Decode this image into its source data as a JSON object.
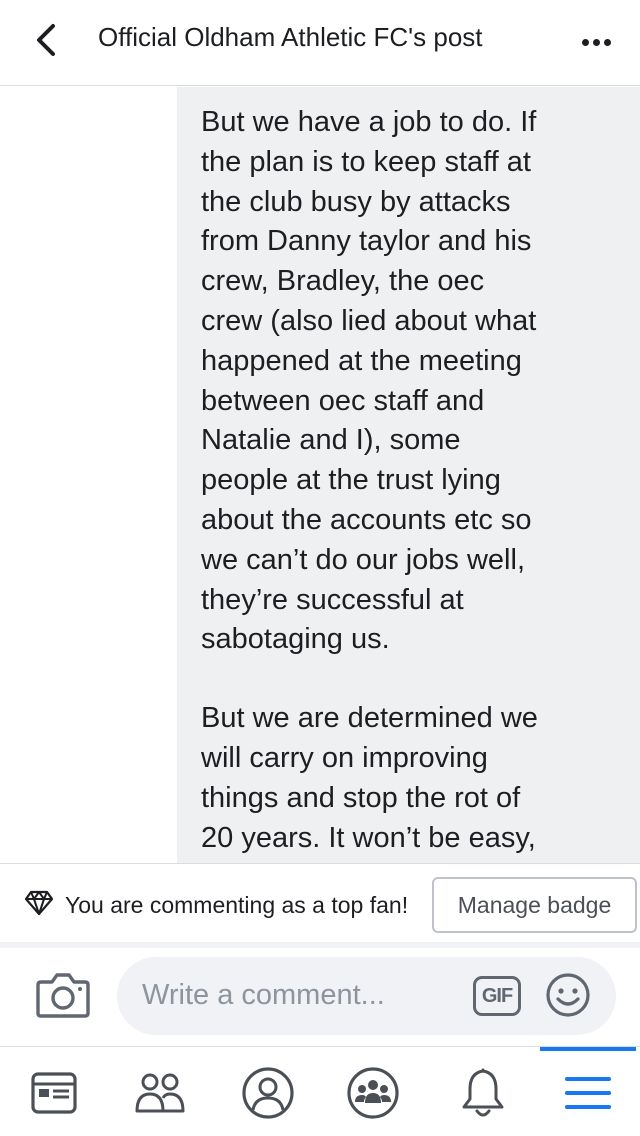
{
  "header": {
    "title": "Official Oldham Athletic FC's post",
    "back_icon": "chevron-left-icon",
    "more_icon": "more-horizontal-icon"
  },
  "post": {
    "paragraphs": [
      "But we have a job to do. If\nthe plan is to keep staff at\nthe club busy by attacks\nfrom Danny taylor and his\ncrew, Bradley, the oec\ncrew (also lied about what\nhappened at the meeting\nbetween oec staff and\nNatalie and I), some\npeople at the trust lying\nabout the accounts etc so\nwe can’t do our jobs well,\nthey’re successful at\nsabotaging us.",
      "But we are determined we\nwill carry on improving\nthings and stop the rot of\n20 years. It won’t be easy,"
    ]
  },
  "fan_bar": {
    "icon": "diamond-icon",
    "text": "You are commenting as a top fan!",
    "button_label": "Manage badge"
  },
  "composer": {
    "camera_icon": "camera-icon",
    "placeholder": "Write a comment...",
    "gif_label": "GIF",
    "emoji_icon": "smiley-icon"
  },
  "tabbar": {
    "items": [
      "news-feed-icon",
      "friends-icon",
      "profile-icon",
      "groups-icon",
      "notifications-icon",
      "menu-icon"
    ],
    "active": "menu-icon",
    "accent_color": "#1877f2",
    "icon_color": "#4267b2"
  }
}
